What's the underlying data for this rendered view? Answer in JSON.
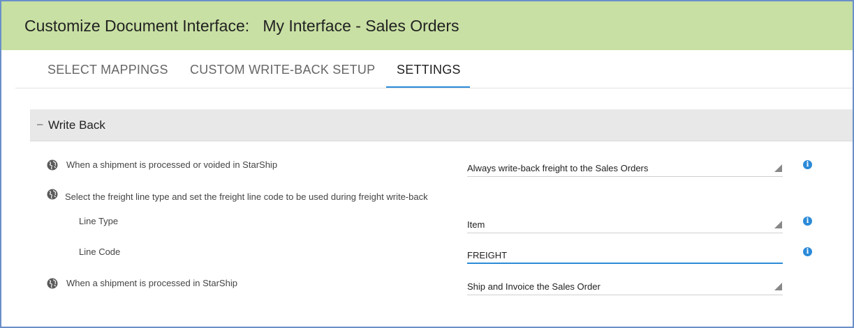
{
  "header": {
    "prefix": "Customize Document Interface:",
    "interface_name": "My Interface - Sales Orders"
  },
  "tabs": [
    {
      "label": "SELECT MAPPINGS",
      "active": false
    },
    {
      "label": "CUSTOM WRITE-BACK SETUP",
      "active": false
    },
    {
      "label": "SETTINGS",
      "active": true
    }
  ],
  "section": {
    "toggle": "–",
    "title": "Write Back"
  },
  "settings": {
    "shipment_processed_or_voided": {
      "label": "When a shipment is processed or voided in StarShip",
      "value": "Always write-back freight to the Sales Orders"
    },
    "freight_line_intro": {
      "label": "Select the freight line type and set the freight line code to be used during freight write-back"
    },
    "line_type": {
      "label": "Line Type",
      "value": "Item"
    },
    "line_code": {
      "label": "Line Code",
      "value": "FREIGHT"
    },
    "shipment_processed": {
      "label": "When a shipment is processed in StarShip",
      "value": "Ship and Invoice the Sales Order"
    }
  },
  "icons": {
    "globe": "globe-icon",
    "info": "info-icon",
    "dropdown": "dropdown-caret-icon"
  },
  "colors": {
    "header_bg": "#c8e0a3",
    "accent": "#2b8ad8",
    "section_bg": "#e8e8e8",
    "frame_border": "#6a8fc9"
  }
}
